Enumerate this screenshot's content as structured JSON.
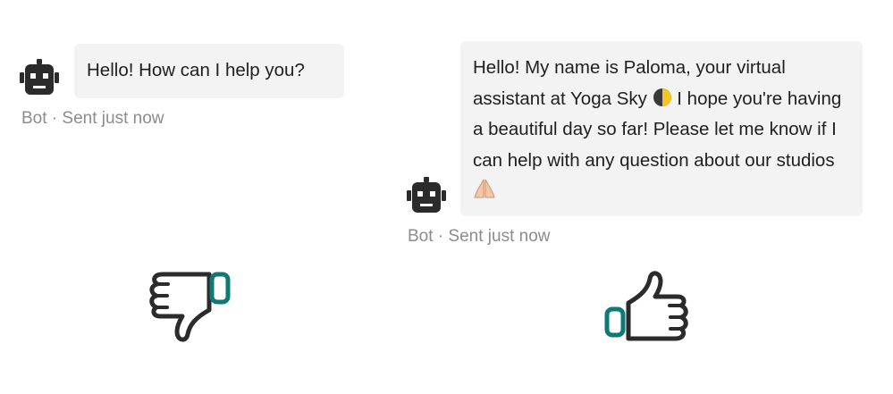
{
  "left_chat": {
    "message": "Hello! How can I help you?",
    "sender": "Bot",
    "separator": " · ",
    "status": "Sent just now",
    "rating_icon": "thumbs-down-icon"
  },
  "right_chat": {
    "message_part1": "Hello! My name is Paloma, your virtual assistant at Yoga Sky",
    "message_part2": " I hope you're having a beautiful day so far! Please let me know if I can help with any question about our studios",
    "sender": "Bot",
    "separator": " · ",
    "status": "Sent just now",
    "rating_icon": "thumbs-up-icon"
  },
  "colors": {
    "bubble": "#f3f3f3",
    "meta_text": "#8c8c8c",
    "icon": "#2b2b2b",
    "accent_teal": "#0f7a75"
  }
}
